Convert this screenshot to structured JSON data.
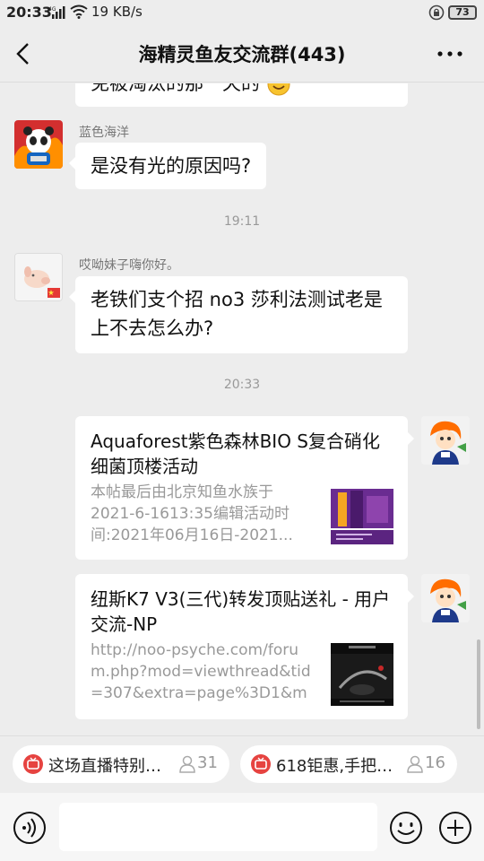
{
  "status_bar": {
    "time": "20:33",
    "network": "4G",
    "speed": "19 KB/s",
    "battery": "73"
  },
  "header": {
    "title": "海精灵鱼友交流群(443)",
    "back_icon": "back-arrow-icon",
    "more_icon": "more-dots-icon"
  },
  "messages": {
    "partial_text": "免被淘汰的那一天的",
    "msg1": {
      "sender": "蓝色海洋",
      "text": "是没有光的原因吗?"
    },
    "time1": "19:11",
    "msg2": {
      "sender": "哎呦妹子嗨你好。",
      "text": "老铁们支个招  no3 莎利法测试老是上不去怎么办?"
    },
    "time2": "20:33",
    "card1": {
      "title": "Aquaforest紫色森林BIO S复合硝化细菌顶楼活动",
      "desc": "本帖最后由北京知鱼水族于 2021-6-1613:35编辑活动时间:2021年06月16日-2021..."
    },
    "card2": {
      "title": "纽斯K7 V3(三代)转发顶贴送礼 - 用户交流-NP",
      "desc": "http://noo-psyche.com/forum.php?mod=viewthread&tid=307&extra=page%3D1&mo..."
    }
  },
  "live_bar": {
    "chips": [
      {
        "text": "这场直播特别…",
        "count": "31"
      },
      {
        "text": "618钜惠,手把…",
        "count": "16"
      }
    ]
  },
  "input_bar": {
    "placeholder": "",
    "voice_icon": "voice-icon",
    "emoji_icon": "emoji-icon",
    "plus_icon": "plus-icon"
  },
  "colors": {
    "background": "#ededed",
    "bubble": "#ffffff",
    "live_red": "#e64340",
    "muted_text": "#999999"
  }
}
